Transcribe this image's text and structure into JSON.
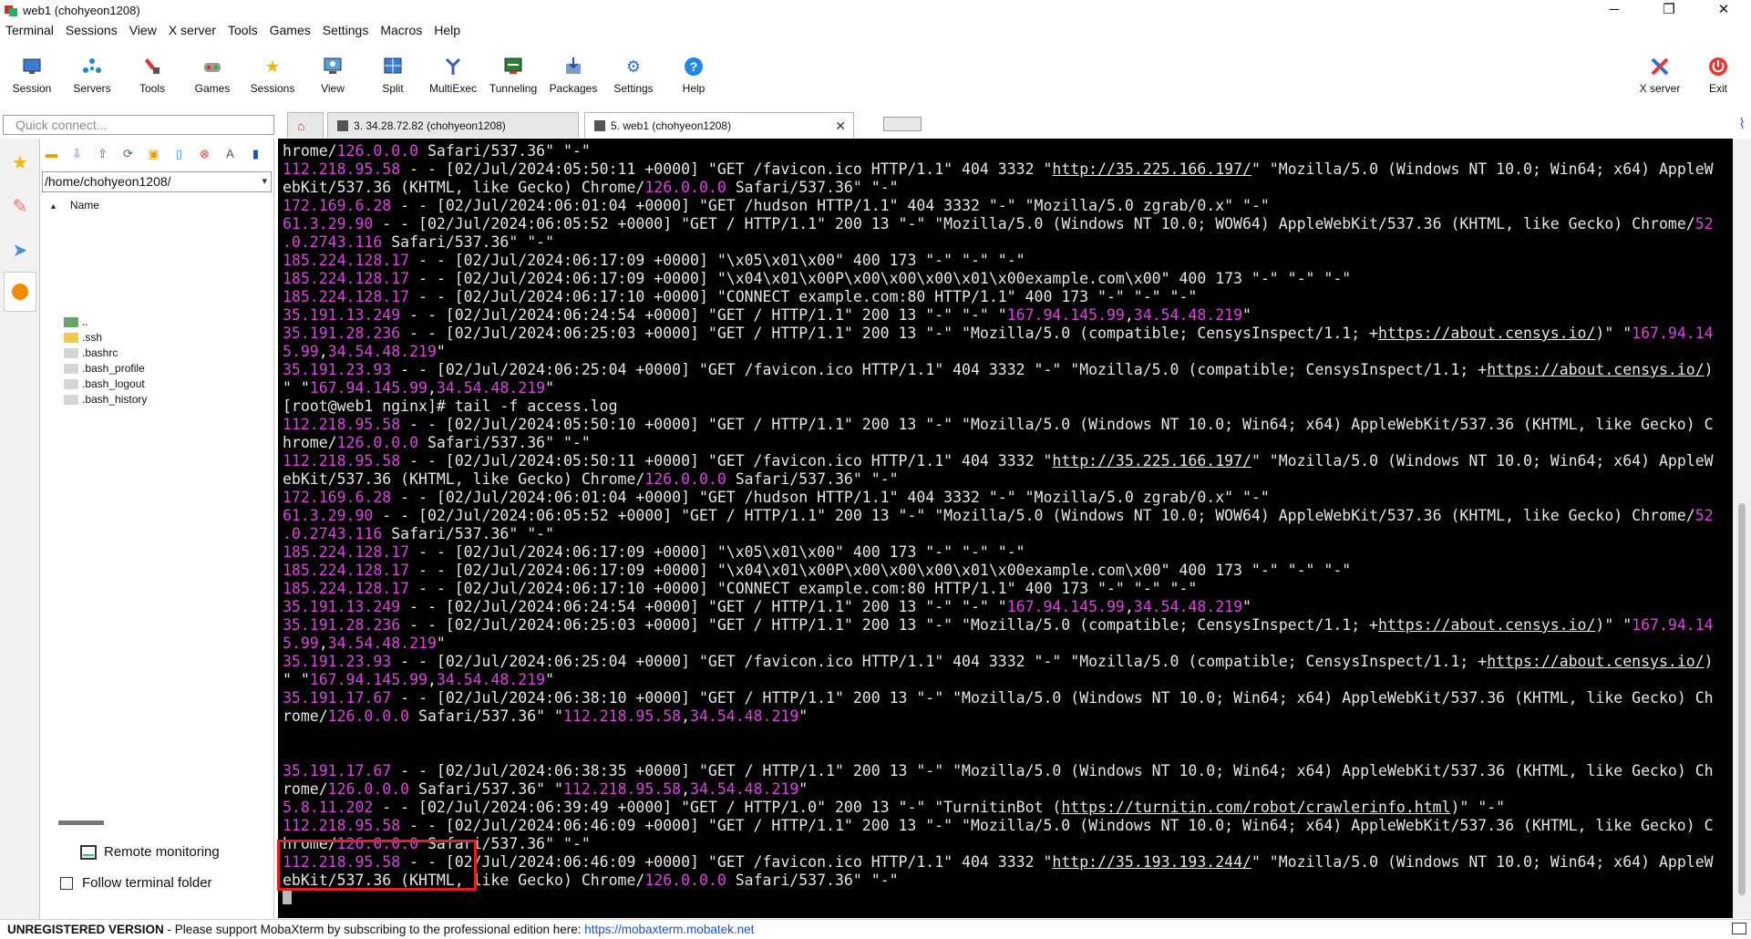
{
  "window": {
    "title": "web1 (chohyeon1208)",
    "minimize": "─",
    "restore": "❐",
    "close": "✕"
  },
  "menu": [
    "Terminal",
    "Sessions",
    "View",
    "X server",
    "Tools",
    "Games",
    "Settings",
    "Macros",
    "Help"
  ],
  "toolbar": {
    "session": "Session",
    "servers": "Servers",
    "tools": "Tools",
    "games": "Games",
    "sessions": "Sessions",
    "view": "View",
    "split": "Split",
    "multiexec": "MultiExec",
    "tunneling": "Tunneling",
    "packages": "Packages",
    "settings": "Settings",
    "help": "Help",
    "xserver": "X server",
    "exit": "Exit"
  },
  "quick_connect": {
    "placeholder": "Quick connect..."
  },
  "tabs": [
    {
      "label": "3. 34.28.72.82 (chohyeon1208)"
    },
    {
      "label": "5. web1 (chohyeon1208)"
    }
  ],
  "file_panel": {
    "path": "/home/chohyeon1208/",
    "column": "Name",
    "items": [
      "..",
      ".ssh",
      ".bashrc",
      ".bash_profile",
      ".bash_logout",
      ".bash_history"
    ],
    "remote_monitoring": "Remote monitoring",
    "follow_terminal": "Follow terminal folder"
  },
  "terminal": {
    "lines": [
      [
        [
          "t",
          "hrome/"
        ],
        [
          "p",
          "126.0.0.0"
        ],
        [
          "t",
          " Safari/537.36\" \"-\""
        ]
      ],
      [
        [
          "p",
          "112.218.95.58"
        ],
        [
          "t",
          " - - [02/Jul/2024:05:50:11 +0000] \"GET /favicon.ico HTTP/1.1\" 404 3332 \""
        ],
        [
          "u",
          "http://35.225.166.197/"
        ],
        [
          "t",
          "\" \"Mozilla/5.0 (Windows NT 10.0; Win64; x64) AppleW"
        ]
      ],
      [
        [
          "t",
          "ebKit/537.36 (KHTML, like Gecko) Chrome/"
        ],
        [
          "p",
          "126.0.0.0"
        ],
        [
          "t",
          " Safari/537.36\" \"-\""
        ]
      ],
      [
        [
          "p",
          "172.169.6.28"
        ],
        [
          "t",
          " - - [02/Jul/2024:06:01:04 +0000] \"GET /hudson HTTP/1.1\" 404 3332 \"-\" \"Mozilla/5.0 zgrab/0.x\" \"-\""
        ]
      ],
      [
        [
          "p",
          "61.3.29.90"
        ],
        [
          "t",
          " - - [02/Jul/2024:06:05:52 +0000] \"GET / HTTP/1.1\" 200 13 \"-\" \"Mozilla/5.0 (Windows NT 10.0; WOW64) AppleWebKit/537.36 (KHTML, like Gecko) Chrome/"
        ],
        [
          "p",
          "52"
        ]
      ],
      [
        [
          "p",
          ".0.2743.116"
        ],
        [
          "t",
          " Safari/537.36\" \"-\""
        ]
      ],
      [
        [
          "p",
          "185.224.128.17"
        ],
        [
          "t",
          " - - [02/Jul/2024:06:17:09 +0000] \"\\x05\\x01\\x00\" 400 173 \"-\" \"-\" \"-\""
        ]
      ],
      [
        [
          "p",
          "185.224.128.17"
        ],
        [
          "t",
          " - - [02/Jul/2024:06:17:09 +0000] \"\\x04\\x01\\x00P\\x00\\x00\\x00\\x01\\x00example.com\\x00\" 400 173 \"-\" \"-\" \"-\""
        ]
      ],
      [
        [
          "p",
          "185.224.128.17"
        ],
        [
          "t",
          " - - [02/Jul/2024:06:17:10 +0000] \"CONNECT example.com:80 HTTP/1.1\" 400 173 \"-\" \"-\" \"-\""
        ]
      ],
      [
        [
          "p",
          "35.191.13.249"
        ],
        [
          "t",
          " - - [02/Jul/2024:06:24:54 +0000] \"GET / HTTP/1.1\" 200 13 \"-\" \"-\" \""
        ],
        [
          "p",
          "167.94.145.99"
        ],
        [
          "t",
          ","
        ],
        [
          "p",
          "34.54.48.219"
        ],
        [
          "t",
          "\""
        ]
      ],
      [
        [
          "p",
          "35.191.28.236"
        ],
        [
          "t",
          " - - [02/Jul/2024:06:25:03 +0000] \"GET / HTTP/1.1\" 200 13 \"-\" \"Mozilla/5.0 (compatible; CensysInspect/1.1; +"
        ],
        [
          "u",
          "https://about.censys.io/"
        ],
        [
          "t",
          ")\" \""
        ],
        [
          "p",
          "167.94.14"
        ]
      ],
      [
        [
          "p",
          "5.99"
        ],
        [
          "t",
          ","
        ],
        [
          "p",
          "34.54.48.219"
        ],
        [
          "t",
          "\""
        ]
      ],
      [
        [
          "p",
          "35.191.23.93"
        ],
        [
          "t",
          " - - [02/Jul/2024:06:25:04 +0000] \"GET /favicon.ico HTTP/1.1\" 404 3332 \"-\" \"Mozilla/5.0 (compatible; CensysInspect/1.1; +"
        ],
        [
          "u",
          "https://about.censys.io/"
        ],
        [
          "t",
          ")"
        ]
      ],
      [
        [
          "t",
          "\" \""
        ],
        [
          "p",
          "167.94.145.99"
        ],
        [
          "t",
          ","
        ],
        [
          "p",
          "34.54.48.219"
        ],
        [
          "t",
          "\""
        ]
      ],
      [
        [
          "t",
          "[root@web1 nginx]# tail -f access.log"
        ]
      ],
      [
        [
          "p",
          "112.218.95.58"
        ],
        [
          "t",
          " - - [02/Jul/2024:05:50:10 +0000] \"GET / HTTP/1.1\" 200 13 \"-\" \"Mozilla/5.0 (Windows NT 10.0; Win64; x64) AppleWebKit/537.36 (KHTML, like Gecko) C"
        ]
      ],
      [
        [
          "t",
          "hrome/"
        ],
        [
          "p",
          "126.0.0.0"
        ],
        [
          "t",
          " Safari/537.36\" \"-\""
        ]
      ],
      [
        [
          "p",
          "112.218.95.58"
        ],
        [
          "t",
          " - - [02/Jul/2024:05:50:11 +0000] \"GET /favicon.ico HTTP/1.1\" 404 3332 \""
        ],
        [
          "u",
          "http://35.225.166.197/"
        ],
        [
          "t",
          "\" \"Mozilla/5.0 (Windows NT 10.0; Win64; x64) AppleW"
        ]
      ],
      [
        [
          "t",
          "ebKit/537.36 (KHTML, like Gecko) Chrome/"
        ],
        [
          "p",
          "126.0.0.0"
        ],
        [
          "t",
          " Safari/537.36\" \"-\""
        ]
      ],
      [
        [
          "p",
          "172.169.6.28"
        ],
        [
          "t",
          " - - [02/Jul/2024:06:01:04 +0000] \"GET /hudson HTTP/1.1\" 404 3332 \"-\" \"Mozilla/5.0 zgrab/0.x\" \"-\""
        ]
      ],
      [
        [
          "p",
          "61.3.29.90"
        ],
        [
          "t",
          " - - [02/Jul/2024:06:05:52 +0000] \"GET / HTTP/1.1\" 200 13 \"-\" \"Mozilla/5.0 (Windows NT 10.0; WOW64) AppleWebKit/537.36 (KHTML, like Gecko) Chrome/"
        ],
        [
          "p",
          "52"
        ]
      ],
      [
        [
          "p",
          ".0.2743.116"
        ],
        [
          "t",
          " Safari/537.36\" \"-\""
        ]
      ],
      [
        [
          "p",
          "185.224.128.17"
        ],
        [
          "t",
          " - - [02/Jul/2024:06:17:09 +0000] \"\\x05\\x01\\x00\" 400 173 \"-\" \"-\" \"-\""
        ]
      ],
      [
        [
          "p",
          "185.224.128.17"
        ],
        [
          "t",
          " - - [02/Jul/2024:06:17:09 +0000] \"\\x04\\x01\\x00P\\x00\\x00\\x00\\x01\\x00example.com\\x00\" 400 173 \"-\" \"-\" \"-\""
        ]
      ],
      [
        [
          "p",
          "185.224.128.17"
        ],
        [
          "t",
          " - - [02/Jul/2024:06:17:10 +0000] \"CONNECT example.com:80 HTTP/1.1\" 400 173 \"-\" \"-\" \"-\""
        ]
      ],
      [
        [
          "p",
          "35.191.13.249"
        ],
        [
          "t",
          " - - [02/Jul/2024:06:24:54 +0000] \"GET / HTTP/1.1\" 200 13 \"-\" \"-\" \""
        ],
        [
          "p",
          "167.94.145.99"
        ],
        [
          "t",
          ","
        ],
        [
          "p",
          "34.54.48.219"
        ],
        [
          "t",
          "\""
        ]
      ],
      [
        [
          "p",
          "35.191.28.236"
        ],
        [
          "t",
          " - - [02/Jul/2024:06:25:03 +0000] \"GET / HTTP/1.1\" 200 13 \"-\" \"Mozilla/5.0 (compatible; CensysInspect/1.1; +"
        ],
        [
          "u",
          "https://about.censys.io/"
        ],
        [
          "t",
          ")\" \""
        ],
        [
          "p",
          "167.94.14"
        ]
      ],
      [
        [
          "p",
          "5.99"
        ],
        [
          "t",
          ","
        ],
        [
          "p",
          "34.54.48.219"
        ],
        [
          "t",
          "\""
        ]
      ],
      [
        [
          "p",
          "35.191.23.93"
        ],
        [
          "t",
          " - - [02/Jul/2024:06:25:04 +0000] \"GET /favicon.ico HTTP/1.1\" 404 3332 \"-\" \"Mozilla/5.0 (compatible; CensysInspect/1.1; +"
        ],
        [
          "u",
          "https://about.censys.io/"
        ],
        [
          "t",
          ")"
        ]
      ],
      [
        [
          "t",
          "\" \""
        ],
        [
          "p",
          "167.94.145.99"
        ],
        [
          "t",
          ","
        ],
        [
          "p",
          "34.54.48.219"
        ],
        [
          "t",
          "\""
        ]
      ],
      [
        [
          "p",
          "35.191.17.67"
        ],
        [
          "t",
          " - - [02/Jul/2024:06:38:10 +0000] \"GET / HTTP/1.1\" 200 13 \"-\" \"Mozilla/5.0 (Windows NT 10.0; Win64; x64) AppleWebKit/537.36 (KHTML, like Gecko) Ch"
        ]
      ],
      [
        [
          "t",
          "rome/"
        ],
        [
          "p",
          "126.0.0.0"
        ],
        [
          "t",
          " Safari/537.36\" \""
        ],
        [
          "p",
          "112.218.95.58"
        ],
        [
          "t",
          ","
        ],
        [
          "p",
          "34.54.48.219"
        ],
        [
          "t",
          "\""
        ]
      ],
      [],
      [],
      [
        [
          "p",
          "35.191.17.67"
        ],
        [
          "t",
          " - - [02/Jul/2024:06:38:35 +0000] \"GET / HTTP/1.1\" 200 13 \"-\" \"Mozilla/5.0 (Windows NT 10.0; Win64; x64) AppleWebKit/537.36 (KHTML, like Gecko) Ch"
        ]
      ],
      [
        [
          "t",
          "rome/"
        ],
        [
          "p",
          "126.0.0.0"
        ],
        [
          "t",
          " Safari/537.36\" \""
        ],
        [
          "p",
          "112.218.95.58"
        ],
        [
          "t",
          ","
        ],
        [
          "p",
          "34.54.48.219"
        ],
        [
          "t",
          "\""
        ]
      ],
      [
        [
          "p",
          "5.8.11.202"
        ],
        [
          "t",
          " - - [02/Jul/2024:06:39:49 +0000] \"GET / HTTP/1.0\" 200 13 \"-\" \"TurnitinBot ("
        ],
        [
          "u",
          "https://turnitin.com/robot/crawlerinfo.html"
        ],
        [
          "t",
          ")\" \"-\""
        ]
      ],
      [
        [
          "p",
          "112.218.95.58"
        ],
        [
          "t",
          " - - [02/Jul/2024:06:46:09 +0000] \"GET / HTTP/1.1\" 200 13 \"-\" \"Mozilla/5.0 (Windows NT 10.0; Win64; x64) AppleWebKit/537.36 (KHTML, like Gecko) C"
        ]
      ],
      [
        [
          "t",
          "hrome/"
        ],
        [
          "p",
          "126.0.0.0"
        ],
        [
          "t",
          " Safari/537.36\" \"-\""
        ]
      ],
      [
        [
          "p",
          "112.218.95.58"
        ],
        [
          "t",
          " - - [02/Jul/2024:06:46:09 +0000] \"GET /favicon.ico HTTP/1.1\" 404 3332 \""
        ],
        [
          "u",
          "http://35.193.193.244/"
        ],
        [
          "t",
          "\" \"Mozilla/5.0 (Windows NT 10.0; Win64; x64) AppleW"
        ]
      ],
      [
        [
          "t",
          "ebKit/537.36 (KHTML, like Gecko) Chrome/"
        ],
        [
          "p",
          "126.0.0.0"
        ],
        [
          "t",
          " Safari/537.36\" \"-\""
        ]
      ]
    ]
  },
  "status": {
    "unregistered": "UNREGISTERED VERSION",
    "message": " -  Please support MobaXterm by subscribing to the professional edition here:  ",
    "link": "https://mobaxterm.mobatek.net"
  },
  "colors": {
    "terminal_bg": "#000000",
    "ip_highlight": "#e040e0",
    "highlight_box": "#e02020"
  }
}
